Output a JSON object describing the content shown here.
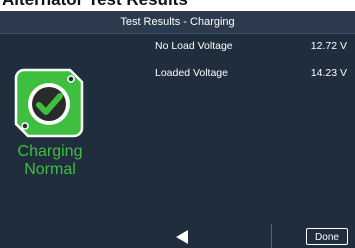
{
  "page": {
    "heading": "Alternator Test Results"
  },
  "screen": {
    "title": "Test Results - Charging",
    "results": [
      {
        "label": "No Load Voltage",
        "value": "12.72 V"
      },
      {
        "label": "Loaded Voltage",
        "value": "14.23 V"
      }
    ],
    "status": {
      "line1": "Charging",
      "line2": "Normal",
      "icon": "checkmark-icon",
      "color": "#3fbf3f"
    },
    "footer": {
      "back_icon": "back-arrow-icon",
      "done_label": "Done"
    }
  }
}
